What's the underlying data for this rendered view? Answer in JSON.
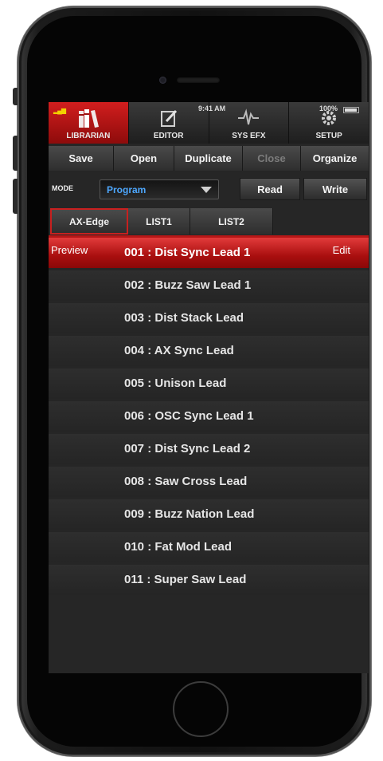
{
  "status": {
    "time": "9:41 AM",
    "battery": "100%"
  },
  "tabs": [
    {
      "label": "LIBRARIAN",
      "icon": "books-icon",
      "active": true
    },
    {
      "label": "EDITOR",
      "icon": "edit-icon",
      "active": false
    },
    {
      "label": "SYS EFX",
      "icon": "effects-icon",
      "active": false
    },
    {
      "label": "SETUP",
      "icon": "gear-icon",
      "active": false
    }
  ],
  "actions": {
    "save": "Save",
    "open": "Open",
    "duplicate": "Duplicate",
    "close": "Close",
    "organize": "Organize"
  },
  "mode": {
    "label": "MODE",
    "selected": "Program",
    "read": "Read",
    "write": "Write"
  },
  "list_tabs": [
    "AX-Edge",
    "LIST1",
    "LIST2"
  ],
  "selected_row": {
    "preview": "Preview",
    "edit": "Edit"
  },
  "patches": [
    "001 : Dist Sync Lead 1",
    "002 : Buzz Saw Lead 1",
    "003 : Dist Stack Lead",
    "004 : AX Sync Lead",
    "005 : Unison Lead",
    "006 : OSC Sync Lead 1",
    "007 : Dist Sync Lead 2",
    "008 : Saw Cross Lead",
    "009 : Buzz Nation Lead",
    "010 : Fat Mod Lead",
    "011 : Super Saw Lead"
  ],
  "colors": {
    "accent": "#c8201f",
    "mode_value": "#4ea8ff"
  }
}
